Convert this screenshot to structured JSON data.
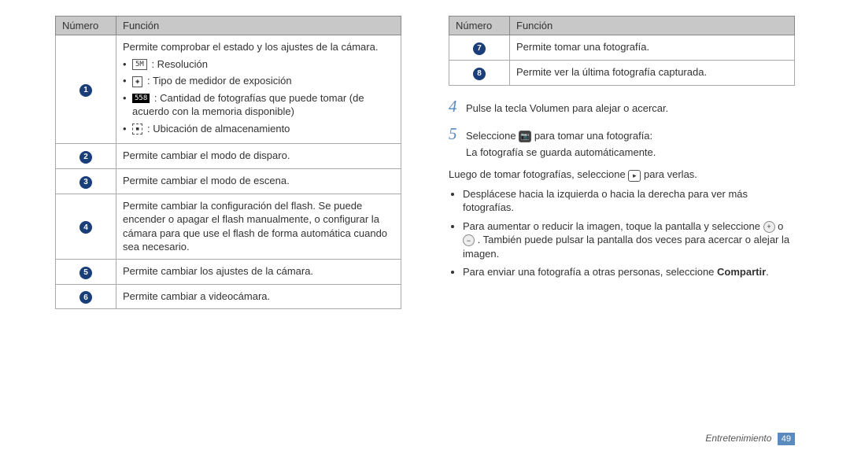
{
  "left_table": {
    "headers": [
      "Número",
      "Función"
    ],
    "rows": [
      {
        "num": "1",
        "intro": "Permite comprobar el estado y los ajustes de la cámara.",
        "items": [
          {
            "icon_class": "iconbox",
            "icon_label": "5M",
            "text": " : Resolución"
          },
          {
            "icon_class": "iconbox",
            "icon_label": "◈",
            "text": " : Tipo de medidor de exposición"
          },
          {
            "icon_class": "iconbox black",
            "icon_label": "558",
            "text": " : Cantidad de fotografías que puede tomar (de acuerdo con la memoria disponible)"
          },
          {
            "icon_class": "iconbox dashed",
            "icon_label": "▪",
            "text": " : Ubicación de almacenamiento"
          }
        ]
      },
      {
        "num": "2",
        "func": "Permite cambiar el modo de disparo."
      },
      {
        "num": "3",
        "func": "Permite cambiar el modo de escena."
      },
      {
        "num": "4",
        "func": "Permite cambiar la configuración del flash. Se puede encender o apagar el flash manualmente, o configurar la cámara para que use el flash de forma automática cuando sea necesario."
      },
      {
        "num": "5",
        "func": "Permite cambiar los ajustes de la cámara."
      },
      {
        "num": "6",
        "func": "Permite cambiar a videocámara."
      }
    ]
  },
  "right_table": {
    "headers": [
      "Número",
      "Función"
    ],
    "rows": [
      {
        "num": "7",
        "func": "Permite tomar una fotografía."
      },
      {
        "num": "8",
        "func": "Permite ver la última fotografía capturada."
      }
    ]
  },
  "steps": {
    "s4": "Pulse la tecla Volumen para alejar o acercar.",
    "s5a": "Seleccione ",
    "s5b": " para tomar una fotografía:",
    "s5c": "La fotografía se guarda automáticamente."
  },
  "after": {
    "line1a": "Luego de tomar fotografías, seleccione ",
    "line1b": " para verlas.",
    "b1": "Desplácese hacia la izquierda o hacia la derecha para ver más fotografías.",
    "b2a": "Para aumentar o reducir la imagen, toque la pantalla y seleccione ",
    "b2b": " o ",
    "b2c": " . También puede pulsar la pantalla dos veces para acercar o alejar la imagen.",
    "b3a": "Para enviar una fotografía a otras personas, seleccione ",
    "b3_bold": "Compartir",
    "b3b": "."
  },
  "footer": {
    "section": "Entretenimiento",
    "page": "49"
  }
}
